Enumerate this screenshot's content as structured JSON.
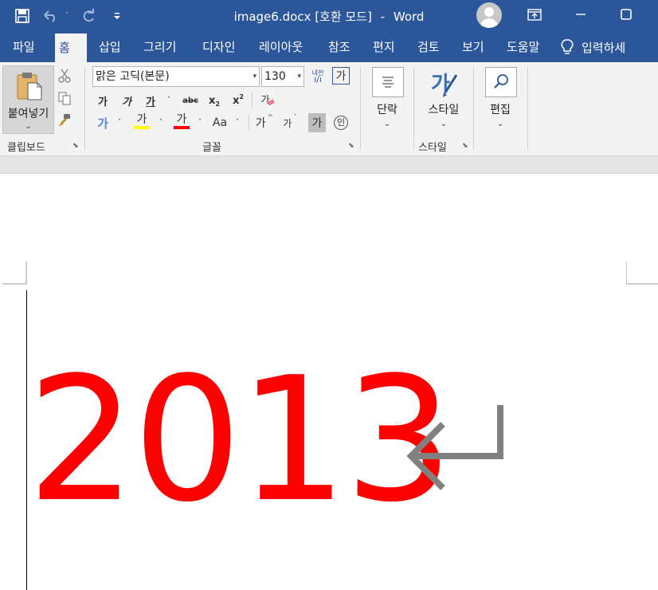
{
  "titlebar": {
    "document_name": "image6.docx",
    "mode": "[호환 모드]",
    "separator": "-",
    "app_name": "Word",
    "icons": [
      "save-icon",
      "undo-icon",
      "redo-icon",
      "customize-qat-icon",
      "user-avatar",
      "ribbon-display-options-icon",
      "restore-icon"
    ]
  },
  "tabs": {
    "items": [
      "파일",
      "홈",
      "삽입",
      "그리기",
      "디자인",
      "레이아웃",
      "참조",
      "편지",
      "검토",
      "보기",
      "도움말"
    ],
    "active": "홈",
    "tell_me": "입력하세"
  },
  "ribbon": {
    "clipboard": {
      "label": "클립보드",
      "paste_label": "붙여넣기"
    },
    "font": {
      "label": "글꼴",
      "font_name": "맑은 고딕(본문)",
      "font_size": "130",
      "glyph_ga": "가",
      "bold_char": "가",
      "italic_char": "가",
      "underline_char": "가",
      "strike_char": "abc",
      "sub_char": "x",
      "sub_digit": "2",
      "sup_char": "x",
      "sup_digit": "2",
      "change_case": "Aa",
      "grow_char": "가",
      "shrink_char": "가",
      "enclose_char": "인",
      "phonetic_top": "내천",
      "clear_char": "가"
    },
    "paragraph": {
      "label": "단락"
    },
    "styles": {
      "label": "스타일",
      "button_label": "스타일"
    },
    "editing": {
      "label": "편집"
    }
  },
  "document": {
    "text": "2013",
    "text_color": "#ff0000",
    "paragraph_mark_color": "#808080"
  },
  "colors": {
    "accent": "#2b579a",
    "ribbon_bg": "#f3f3f3",
    "highlight_yellow": "#ffff00",
    "font_red": "#ff0000"
  }
}
